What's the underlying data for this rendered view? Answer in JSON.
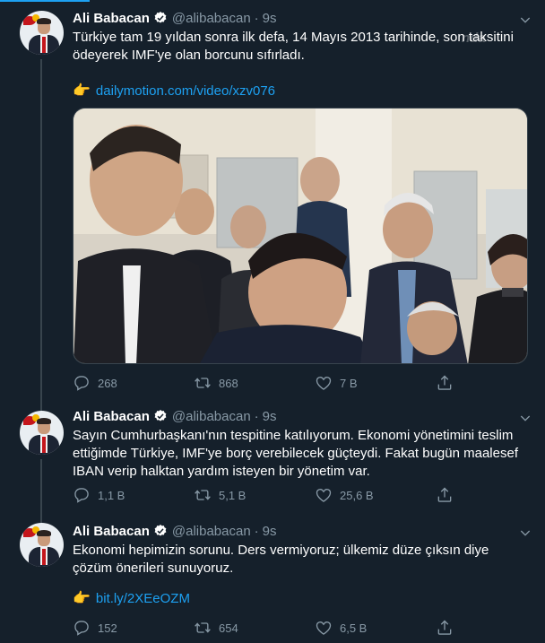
{
  "author": {
    "name": "Ali Babacan",
    "handle": "@alibabacan",
    "avatar_icon": "profile-photo-with-party-logo"
  },
  "colors": {
    "background": "#15202b",
    "accent": "#1da1f2",
    "muted": "#8899a6",
    "border": "#38444d"
  },
  "watermark_text": "nda",
  "tweets": [
    {
      "time": "9s",
      "text": "Türkiye tam 19 yıldan sonra ilk defa, 14 Mayıs 2013 tarihinde, son taksitini ödeyerek IMF'ye olan borcunu sıfırladı.",
      "link_icon": "pointing-hand-emoji",
      "link": "dailymotion.com/video/xzv076",
      "media": "photo-group-of-men-smiling",
      "replies": "268",
      "retweets": "868",
      "likes": "7 B"
    },
    {
      "time": "9s",
      "text": "Sayın Cumhurbaşkanı'nın tespitine katılıyorum. Ekonomi yönetimini teslim ettiğimde Türkiye, IMF'ye borç verebilecek güçteydi. Fakat bugün maalesef IBAN verip halktan yardım isteyen bir yönetim var.",
      "replies": "1,1 B",
      "retweets": "5,1 B",
      "likes": "25,6 B"
    },
    {
      "time": "9s",
      "text": "Ekonomi hepimizin sorunu. Ders vermiyoruz; ülkemiz düze çıksın diye çözüm önerileri sunuyoruz.",
      "link_icon": "pointing-hand-emoji",
      "link": "bit.ly/2XEeOZM",
      "replies": "152",
      "retweets": "654",
      "likes": "6,5 B"
    }
  ]
}
